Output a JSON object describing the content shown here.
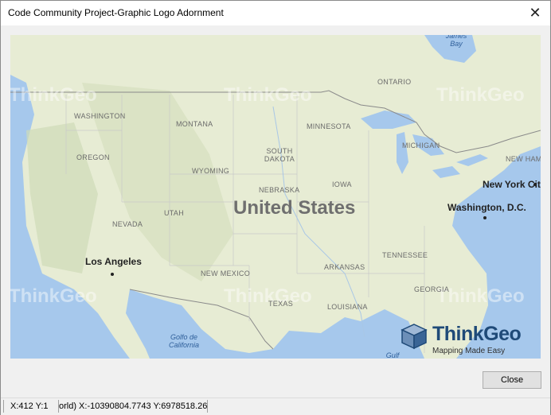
{
  "window": {
    "title": "Code Community Project-Graphic Logo Adornment",
    "close_glyph": "✕"
  },
  "map": {
    "country_label": "United States",
    "state_labels": [
      "WASHINGTON",
      "OREGON",
      "MONTANA",
      "WYOMING",
      "MINNESOTA",
      "SOUTH DAKOTA",
      "NEBRASKA",
      "IOWA",
      "MICHIGAN",
      "UTAH",
      "NEVADA",
      "NEW MEXICO",
      "ARKANSAS",
      "TENNESSEE",
      "GEORGIA",
      "TEXAS",
      "LOUISIANA",
      "ONTARIO",
      "NEW HAMPSHIRE"
    ],
    "cities": [
      {
        "name": "Los Angeles"
      },
      {
        "name": "Washington, D.C."
      },
      {
        "name": "New York City"
      }
    ],
    "water_labels": [
      "James Bay",
      "Golfo de California",
      "Gulf"
    ],
    "watermark_text": "ThinkGeo",
    "logo": {
      "title": "ThinkGeo",
      "tagline": "Mapping Made Easy",
      "icon": "cube-icon"
    }
  },
  "buttons": {
    "close_label": "Close"
  },
  "status": {
    "screen_coords": "X:412 Y:1",
    "world_coords": "orld) X:-10390804.7743 Y:6978518.26"
  },
  "colors": {
    "water": "#a6c8ec",
    "land": "#e9edd8",
    "logo_blue": "#1f4a78"
  }
}
